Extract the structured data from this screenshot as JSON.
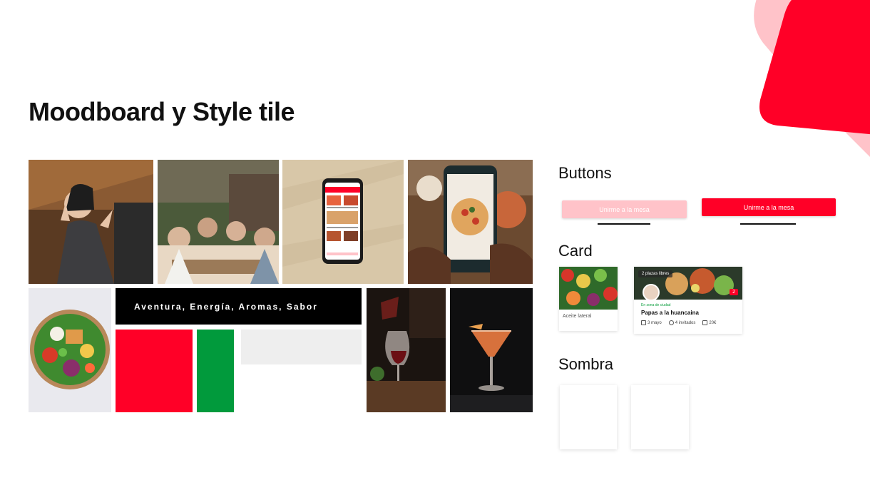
{
  "title": "Moodboard y Style tile",
  "banner_text": "Aventura, Energía, Aromas, Sabor",
  "colors": {
    "primary": "#ff0027",
    "primary_light": "#ffc3c9",
    "green": "#019a3c",
    "gray": "#eeeeee",
    "black": "#000000"
  },
  "moodboard": {
    "images": [
      "woman-peace-sign-photo",
      "friends-toast-garden-photo",
      "phone-app-mockup-photo",
      "phone-photographing-pizza-photo",
      "salad-bowl-photo",
      "wine-pour-photo",
      "cocktail-glass-photo"
    ]
  },
  "sections": {
    "buttons": {
      "heading": "Buttons",
      "light_label": "Unirme a la mesa",
      "solid_label": "Unirme a la mesa"
    },
    "card": {
      "heading": "Card",
      "small_label": "Aceite lateral",
      "large_badge": "2 plazas libres",
      "large_count": "2",
      "large_category": "En zona de ciudad",
      "large_name": "Papas a la huancaina",
      "meta": [
        "3 mayo",
        "4 invitados",
        "20€"
      ]
    },
    "shadow": {
      "heading": "Sombra"
    }
  }
}
